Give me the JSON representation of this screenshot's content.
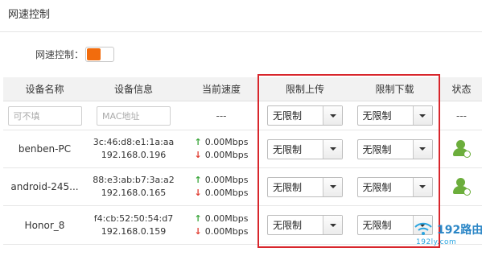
{
  "page": {
    "title": "网速控制"
  },
  "speed_control": {
    "label": "网速控制：",
    "enabled": true,
    "accent_color": "#f26c0d"
  },
  "table": {
    "headers": {
      "device_name": "设备名称",
      "device_info": "设备信息",
      "current_speed": "当前速度",
      "limit_upload": "限制上传",
      "limit_download": "限制下载",
      "status": "状态"
    },
    "input_row": {
      "name_placeholder": "可不填",
      "mac_placeholder": "MAC地址",
      "speed": "---",
      "upload": "无限制",
      "download": "无限制",
      "status": "---"
    },
    "rows": [
      {
        "name": "benben-PC",
        "mac": "3c:46:d8:e1:1a:aa",
        "ip": "192.168.0.196",
        "up": "0.00Mbps",
        "down": "0.00Mbps",
        "upload": "无限制",
        "download": "无限制",
        "status_icon": "user-online-icon"
      },
      {
        "name": "android-245...",
        "mac": "88:e3:ab:b7:3a:a2",
        "ip": "192.168.0.165",
        "up": "0.00Mbps",
        "down": "0.00Mbps",
        "upload": "无限制",
        "download": "无限制",
        "status_icon": "user-online-icon"
      },
      {
        "name": "Honor_8",
        "mac": "f4:cb:52:50:54:d7",
        "ip": "192.168.0.159",
        "up": "0.00Mbps",
        "down": "0.00Mbps",
        "upload": "无限制",
        "download": "无限制",
        "status_icon": "user-online-icon"
      }
    ]
  },
  "icons": {
    "up_arrow": "↑",
    "down_arrow": "↓"
  },
  "colors": {
    "highlight": "#d8262c",
    "up": "#3aa53a",
    "down": "#e03b2f",
    "online": "#6cae3c"
  },
  "watermark": {
    "title": "192路由网",
    "subtitle": "192ly.com"
  }
}
